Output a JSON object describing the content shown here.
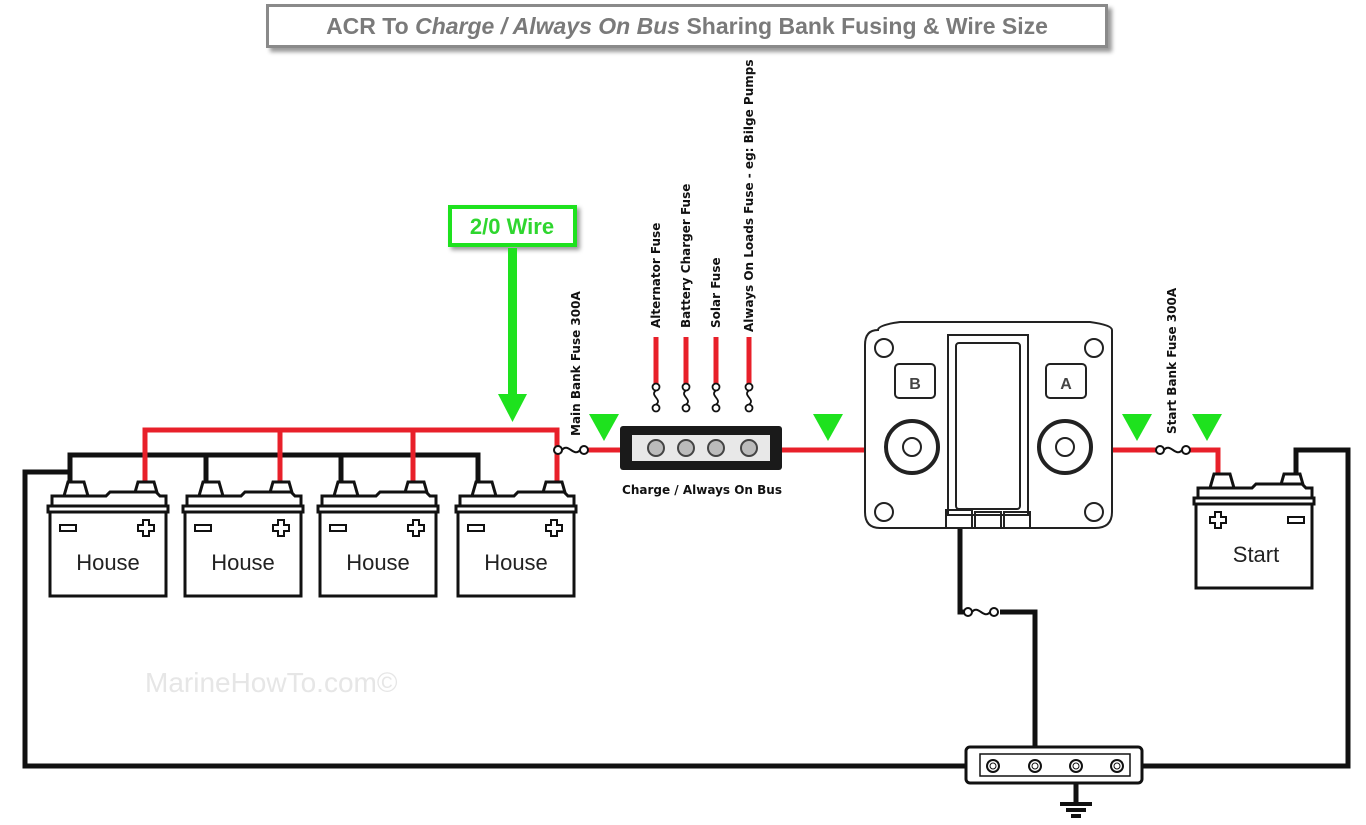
{
  "title": {
    "part1": "ACR To ",
    "part2_italic": "Charge / Always On Bus",
    "part3": " Sharing Bank Fusing & Wire Size"
  },
  "wire_callout": {
    "label": "2/0 Wire",
    "color": "#2fd62f"
  },
  "fuse_labels": {
    "main_bank": "Main Bank Fuse 300A",
    "alternator": "Alternator Fuse",
    "battery_charger": "Battery Charger Fuse",
    "solar": "Solar Fuse",
    "always_on_loads": "Always On Loads Fuse - eg: Bilge Pumps",
    "start_bank": "Start Bank Fuse 300A"
  },
  "bus_label": "Charge / Always On Bus",
  "acr": {
    "terminal_b": "B",
    "terminal_a": "A"
  },
  "batteries": [
    {
      "label": "House",
      "neg": "−",
      "pos": "+"
    },
    {
      "label": "House",
      "neg": "−",
      "pos": "+"
    },
    {
      "label": "House",
      "neg": "−",
      "pos": "+"
    },
    {
      "label": "House",
      "neg": "−",
      "pos": "+"
    },
    {
      "label": "Start",
      "neg": "−",
      "pos": "+"
    }
  ],
  "watermark": "MarineHowTo.com©",
  "colors": {
    "positive": "#e8202a",
    "negative": "#111111",
    "marker": "#1ee21e"
  }
}
